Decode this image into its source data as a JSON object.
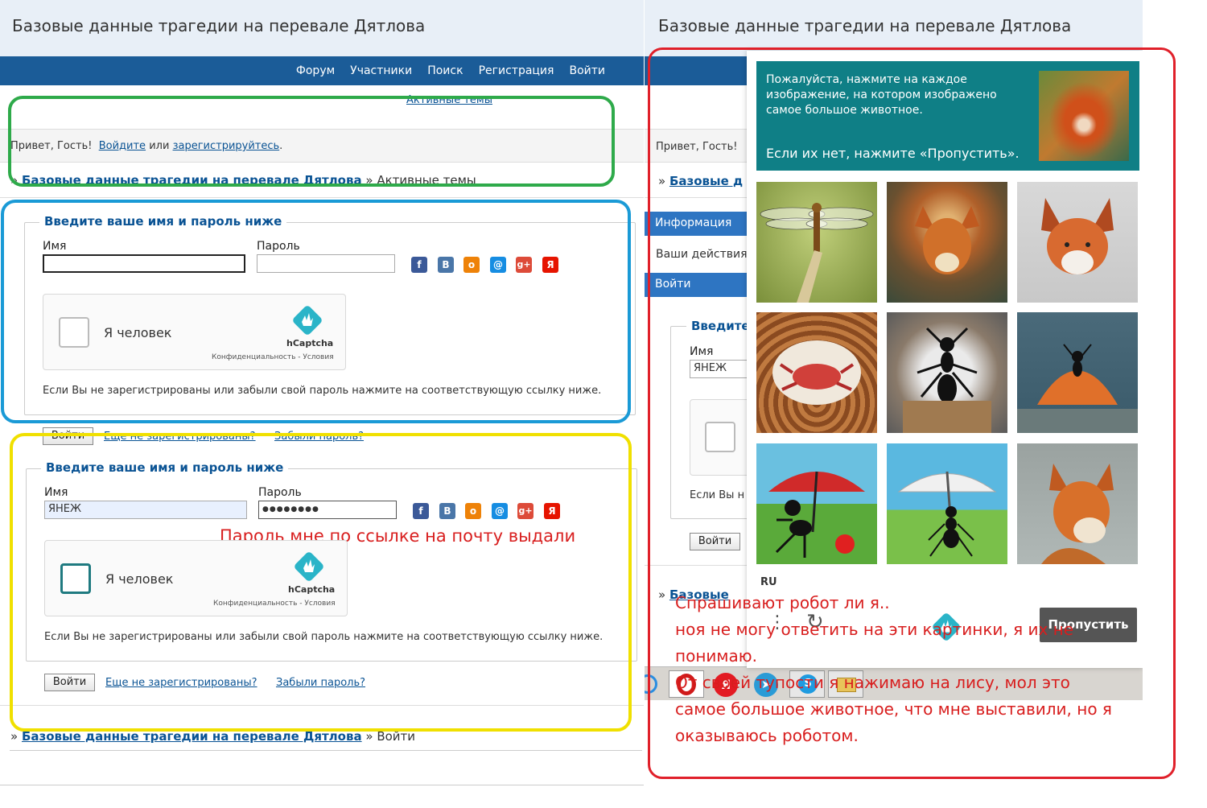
{
  "site_title": "Базовые данные трагедии на перевале Дятлова",
  "nav": [
    "Форум",
    "Участники",
    "Поиск",
    "Регистрация",
    "Войти"
  ],
  "active_topics": "Активные темы",
  "greeting": "Привет, Гость!",
  "login_link": "Войдите",
  "or_text": "или",
  "register_link": "зарегистрируйтесь",
  "breadcrumb": {
    "prefix": "»",
    "home": "Базовые данные трагедии на перевале Дятлова",
    "sep": "»",
    "current_topics": "Активные темы",
    "current_login": "Войти"
  },
  "login_form": {
    "legend": "Введите ваше имя и пароль ниже",
    "name_label": "Имя",
    "password_label": "Пароль",
    "filled_name": "ЯНЕЖ",
    "filled_password": "●●●●●●●●",
    "hint": "Если Вы не зарегистрированы или забыли свой пароль нажмите на соответствующую ссылку ниже.",
    "submit": "Войти",
    "not_registered": "Еще не зарегистрированы?",
    "forgot": "Забыли пароль?"
  },
  "social_icons": [
    {
      "name": "facebook-icon",
      "glyph": "f",
      "color": "#3b5998"
    },
    {
      "name": "vkontakte-icon",
      "glyph": "В",
      "color": "#4a76a8"
    },
    {
      "name": "odnoklassniki-icon",
      "glyph": "о",
      "color": "#ee8208"
    },
    {
      "name": "mailru-icon",
      "glyph": "@",
      "color": "#168de2"
    },
    {
      "name": "googleplus-icon",
      "glyph": "g+",
      "color": "#dd4b39"
    },
    {
      "name": "yandex-icon",
      "glyph": "Я",
      "color": "#e61400"
    }
  ],
  "hcaptcha": {
    "label": "Я человек",
    "brand": "hCaptcha",
    "footer": "Конфиденциальность - Условия"
  },
  "annotation_password": "Пароль мне по ссылке на почту выдали",
  "right_side": {
    "greeting": "Привет, Гость!",
    "breadcrumb_partial": "Базовые д",
    "breadcrumb_partial2": "Базовые",
    "menu_info": "Информация",
    "menu_actions": "Ваши действия",
    "menu_login": "Войти",
    "legend_partial": "Введите",
    "name_label": "Имя",
    "name_value": "ЯНЕЖ",
    "hint_partial": "Если Вы н",
    "submit": "Войти"
  },
  "challenge": {
    "prompt": "Пожалуйста, нажмите на каждое изображение, на котором изображено самое большое животное.",
    "skip_hint": "Если их нет, нажмите «Пропустить».",
    "tiles": [
      "dragonfly",
      "fox-painting",
      "fox-sketch",
      "crab-in-basket",
      "ant-sphere",
      "ant-orange-dome",
      "ant-red-umbrella",
      "ant-white-umbrella",
      "fox-portrait"
    ],
    "lang": "RU",
    "skip_button": "Пропустить"
  },
  "annotation_right": [
    "Спрашивают робот ли я..",
    "ноя не могу ответить на эти картинки, я их не",
    "понимаю.",
    "От своей тупости я нажимаю на лису, мол это",
    "самое большое животное, что мне выставили, но я",
    "оказываюсь роботом."
  ],
  "colors": {
    "nav_bg": "#1b5c98",
    "header_bg": "#e8eff7",
    "challenge_header": "#0f7f86",
    "green_box": "#2eaa4a",
    "blue_box": "#1a9ad6",
    "yellow_box": "#f0e000",
    "red_box": "#e0202a"
  }
}
